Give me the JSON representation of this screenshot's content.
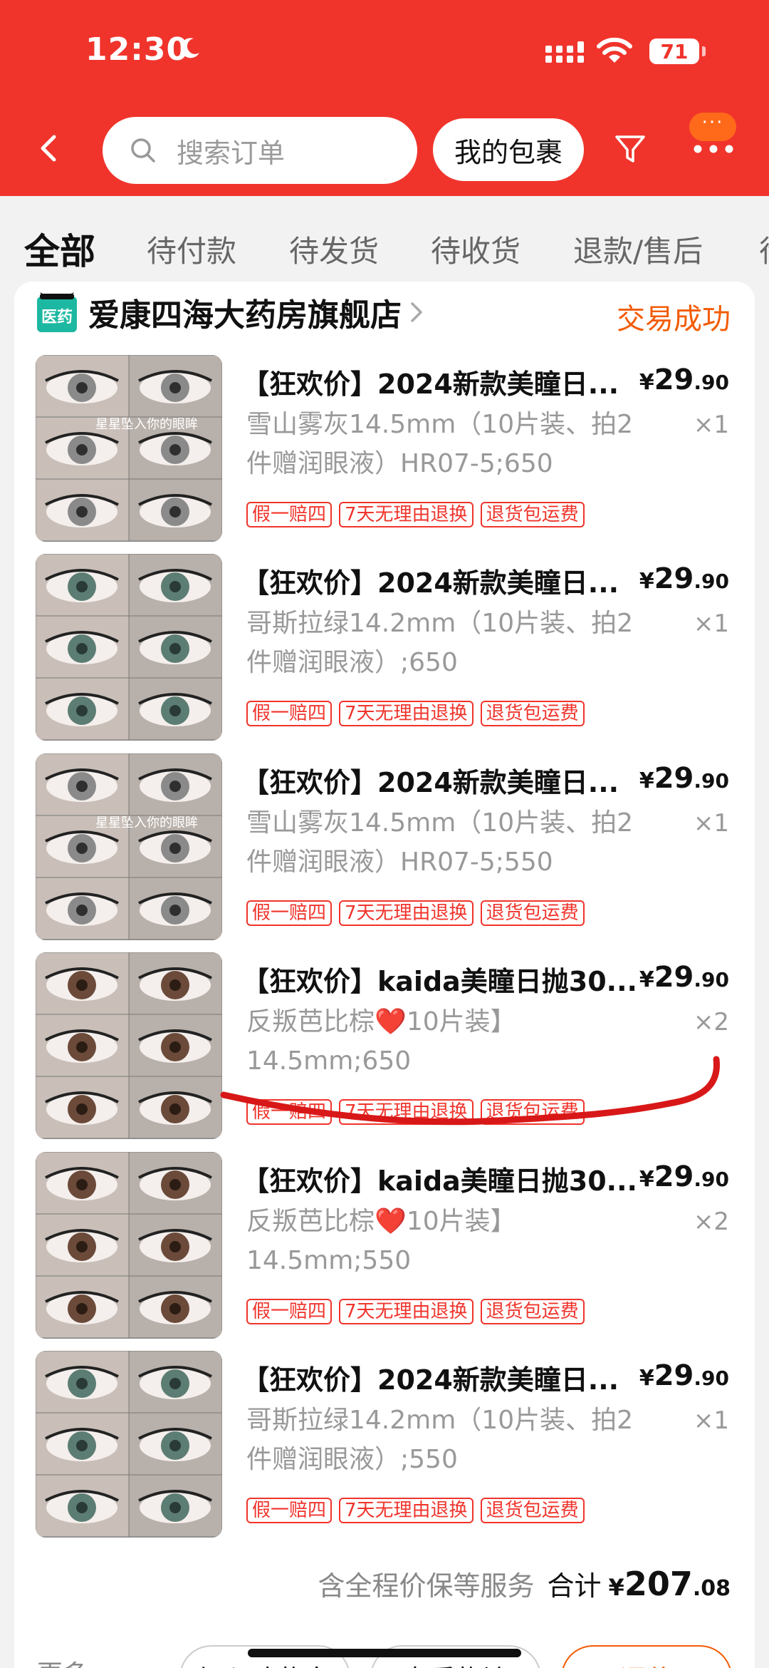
{
  "status_bar": {
    "time": "12:30",
    "battery": "71"
  },
  "header": {
    "search_placeholder": "搜索订单",
    "my_packages": "我的包裹",
    "more_badge": "···"
  },
  "tabs": [
    "全部",
    "待付款",
    "待发货",
    "待收货",
    "退款/售后",
    "待"
  ],
  "order": {
    "shop_name": "爱康四海大药房旗舰店",
    "shop_badge": "医药",
    "status": "交易成功",
    "items": [
      {
        "title": "【狂欢价】2024新款美瞳日...",
        "spec": "雪山雾灰14.5mm（10片装、拍2件赠润眼液）HR07-5;650",
        "price_currency": "¥",
        "price_int": "29",
        "price_dec": ".90",
        "qty": "×1",
        "tags": [
          "假一赔四",
          "7天无理由退换",
          "退货包运费"
        ],
        "thumb_caption": "星星坠入你的眼眸"
      },
      {
        "title": "【狂欢价】2024新款美瞳日...",
        "spec": "哥斯拉绿14.2mm（10片装、拍2件赠润眼液）;650",
        "price_currency": "¥",
        "price_int": "29",
        "price_dec": ".90",
        "qty": "×1",
        "tags": [
          "假一赔四",
          "7天无理由退换",
          "退货包运费"
        ],
        "thumb_caption": ""
      },
      {
        "title": "【狂欢价】2024新款美瞳日...",
        "spec": "雪山雾灰14.5mm（10片装、拍2件赠润眼液）HR07-5;550",
        "price_currency": "¥",
        "price_int": "29",
        "price_dec": ".90",
        "qty": "×1",
        "tags": [
          "假一赔四",
          "7天无理由退换",
          "退货包运费"
        ],
        "thumb_caption": "星星坠入你的眼眸"
      },
      {
        "title": "【狂欢价】kaida美瞳日抛30...",
        "spec": "反叛芭比棕❤️10片装】14.5mm;650",
        "price_currency": "¥",
        "price_int": "29",
        "price_dec": ".90",
        "qty": "×2",
        "tags": [
          "假一赔四",
          "7天无理由退换",
          "退货包运费"
        ],
        "thumb_caption": ""
      },
      {
        "title": "【狂欢价】kaida美瞳日抛30...",
        "spec": "反叛芭比棕❤️10片装】14.5mm;550",
        "price_currency": "¥",
        "price_int": "29",
        "price_dec": ".90",
        "qty": "×2",
        "tags": [
          "假一赔四",
          "7天无理由退换",
          "退货包运费"
        ],
        "thumb_caption": ""
      },
      {
        "title": "【狂欢价】2024新款美瞳日...",
        "spec": "哥斯拉绿14.2mm（10片装、拍2件赠润眼液）;550",
        "price_currency": "¥",
        "price_int": "29",
        "price_dec": ".90",
        "qty": "×1",
        "tags": [
          "假一赔四",
          "7天无理由退换",
          "退货包运费"
        ],
        "thumb_caption": ""
      }
    ],
    "service_note": "含全程价保等服务",
    "total_label": "合计",
    "total_currency": "¥",
    "total_int": "207",
    "total_dec": ".08"
  },
  "actions": {
    "more": "更多",
    "add_cart": "加入购物车",
    "view_logistics": "查看物流",
    "review": "评价"
  },
  "colors": {
    "brand_red": "#f0342c",
    "accent_orange": "#f25c05",
    "annotation_red": "#d81818"
  }
}
